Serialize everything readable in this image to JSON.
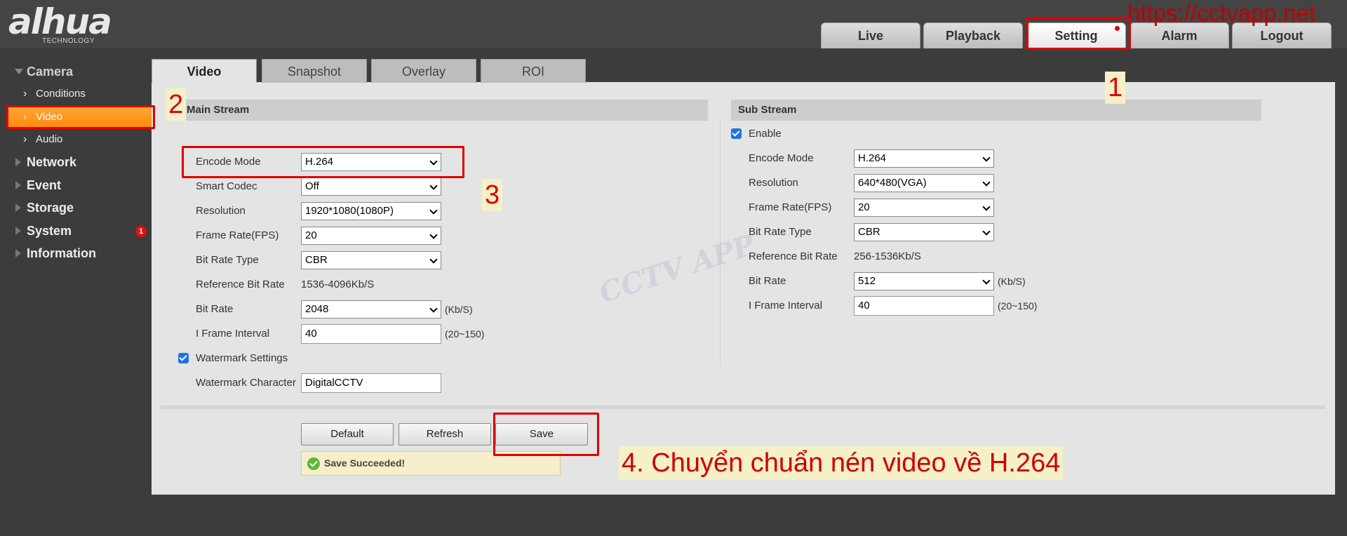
{
  "brand": {
    "logo": "alhua",
    "tagline": "TECHNOLOGY"
  },
  "site_watermark": "https://cctvapp.net",
  "image_watermark": "CCTV APP",
  "top_tabs": [
    "Live",
    "Playback",
    "Setting",
    "Alarm",
    "Logout"
  ],
  "active_top_tab": "Setting",
  "sidebar": {
    "camera": "Camera",
    "camera_items": [
      "Conditions",
      "Video",
      "Audio"
    ],
    "selected": "Video",
    "sections": [
      "Network",
      "Event",
      "Storage",
      "System",
      "Information"
    ],
    "system_badge": "1"
  },
  "sub_tabs": [
    "Video",
    "Snapshot",
    "Overlay",
    "ROI"
  ],
  "active_sub_tab": "Video",
  "main_stream": {
    "title": "Main Stream",
    "encode_mode_label": "Encode Mode",
    "encode_mode": "H.264",
    "smart_codec_label": "Smart Codec",
    "smart_codec": "Off",
    "resolution_label": "Resolution",
    "resolution": "1920*1080(1080P)",
    "frame_rate_label": "Frame Rate(FPS)",
    "frame_rate": "20",
    "bit_rate_type_label": "Bit Rate Type",
    "bit_rate_type": "CBR",
    "reference_bit_rate_label": "Reference Bit Rate",
    "reference_bit_rate": "1536-4096Kb/S",
    "bit_rate_label": "Bit Rate",
    "bit_rate": "2048",
    "bit_rate_unit": "(Kb/S)",
    "i_frame_interval_label": "I Frame Interval",
    "i_frame_interval": "40",
    "i_frame_range": "(20~150)",
    "watermark_settings_label": "Watermark Settings",
    "watermark_enabled": true,
    "watermark_character_label": "Watermark Character",
    "watermark_character": "DigitalCCTV"
  },
  "sub_stream": {
    "title": "Sub Stream",
    "enable_label": "Enable",
    "enabled": true,
    "encode_mode_label": "Encode Mode",
    "encode_mode": "H.264",
    "resolution_label": "Resolution",
    "resolution": "640*480(VGA)",
    "frame_rate_label": "Frame Rate(FPS)",
    "frame_rate": "20",
    "bit_rate_type_label": "Bit Rate Type",
    "bit_rate_type": "CBR",
    "reference_bit_rate_label": "Reference Bit Rate",
    "reference_bit_rate": "256-1536Kb/S",
    "bit_rate_label": "Bit Rate",
    "bit_rate": "512",
    "bit_rate_unit": "(Kb/S)",
    "i_frame_interval_label": "I Frame Interval",
    "i_frame_interval": "40",
    "i_frame_range": "(20~150)"
  },
  "buttons": {
    "default": "Default",
    "refresh": "Refresh",
    "save": "Save"
  },
  "status_message": "Save Succeeded!",
  "annotations": {
    "step1": "1",
    "step2": "2",
    "step3": "3",
    "step4": "4. Chuyển chuẩn nén video về H.264",
    "highlight_color": "#e00000"
  }
}
